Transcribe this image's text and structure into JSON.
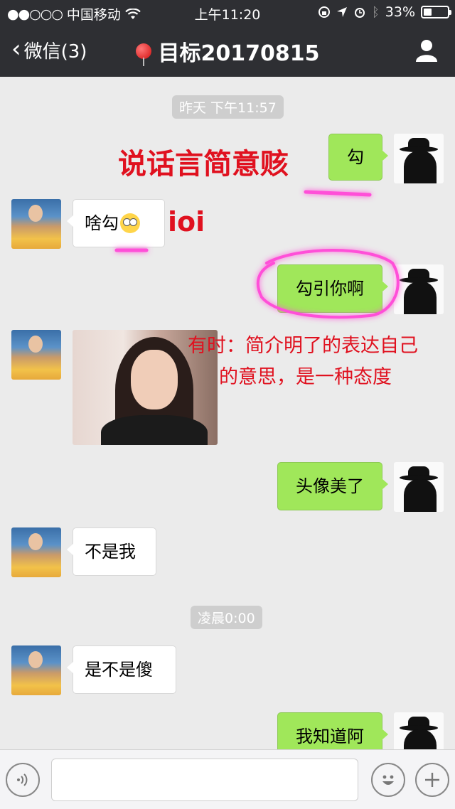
{
  "status_bar": {
    "signal": "●●○○○",
    "carrier": "中国移动",
    "time": "上午11:20",
    "battery_text": "33%",
    "battery_level": 0.33
  },
  "nav": {
    "back_label": "微信(3)",
    "title": "目标20170815"
  },
  "timestamps": [
    "昨天 下午11:57",
    "凌晨0:00"
  ],
  "messages": [
    {
      "side": "right",
      "text": "勾"
    },
    {
      "side": "left",
      "text": "啥勾"
    },
    {
      "side": "right",
      "text": "勾引你啊"
    },
    {
      "side": "left",
      "type": "image"
    },
    {
      "side": "right",
      "text": "头像美了"
    },
    {
      "side": "left",
      "text": "不是我"
    },
    {
      "side": "left",
      "text": "是不是傻"
    },
    {
      "side": "right",
      "text": "我知道阿"
    }
  ],
  "annotations": {
    "concise": "说话言简意赅",
    "ioi": "ioi",
    "note_line1": "有时：简介明了的表达自己",
    "note_line2": "的意思，是一种态度"
  },
  "colors": {
    "nav_bg": "#2e2f33",
    "chat_bg": "#ebebeb",
    "bubble_green": "#a0e75a",
    "annotation_red": "#e0111f",
    "highlight_pink": "#ff4fd8"
  }
}
